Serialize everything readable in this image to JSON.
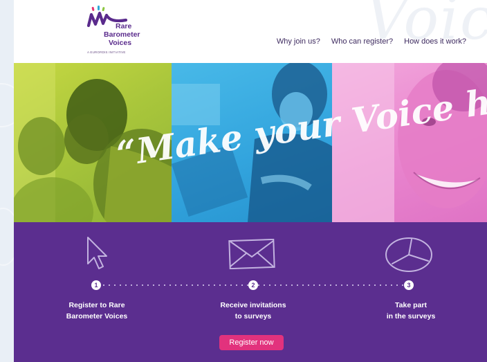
{
  "logo": {
    "name_lines": [
      "Rare",
      "Barometer",
      "Voices"
    ],
    "tagline": "A EURORDIS INITIATIVE",
    "colors": [
      "#e5336f",
      "#2ea8d9",
      "#8cc63f",
      "#5a2b8c"
    ]
  },
  "nav": {
    "items": [
      {
        "label": "Why join us?"
      },
      {
        "label": "Who can register?"
      },
      {
        "label": "How does it work?"
      }
    ]
  },
  "hero": {
    "quote": "“Make your Voice heard!”",
    "panel_colors": {
      "green": "#b5cd3d",
      "blue": "#3aa8e0",
      "pink": "#eb8fd3"
    }
  },
  "steps": [
    {
      "number": "1",
      "icon": "cursor-icon",
      "lines": [
        "Register to Rare",
        "Barometer Voices"
      ]
    },
    {
      "number": "2",
      "icon": "envelope-icon",
      "lines": [
        "Receive invitations",
        "to surveys"
      ]
    },
    {
      "number": "3",
      "icon": "pie-chart-icon",
      "lines": [
        "Take part",
        "in the surveys"
      ]
    }
  ],
  "cta": {
    "label": "Register now",
    "color": "#e2327d"
  },
  "colors": {
    "brand_purple": "#5b2e8f",
    "accent_pink": "#e2327d"
  }
}
